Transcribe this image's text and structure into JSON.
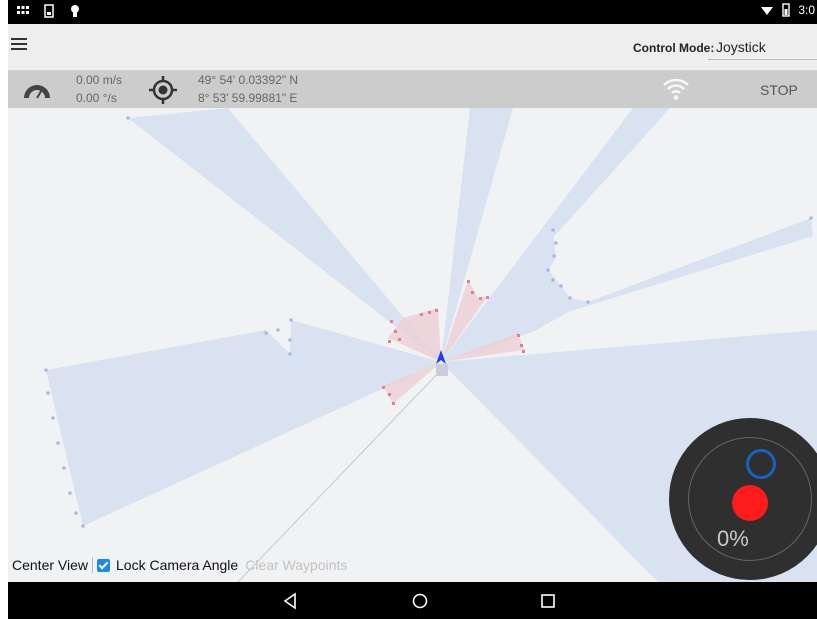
{
  "status_bar": {
    "time": "3:0",
    "icons": [
      "grid-icon",
      "sd-card-icon",
      "android-icon",
      "wifi-icon",
      "battery-icon"
    ]
  },
  "app_bar": {
    "control_mode_label": "Control Mode:",
    "control_mode_value": "Joystick"
  },
  "info_bar": {
    "speed_linear": "0.00 m/s",
    "speed_angular": "0.00 °/s",
    "latitude": "49° 54' 0.03392\" N",
    "longitude": "8° 53' 59.99881\" E",
    "stop_label": "STOP"
  },
  "controls": {
    "center_view": "Center View",
    "lock_camera_angle": "Lock Camera Angle",
    "lock_checked": true,
    "clear_waypoints": "Clear Waypoints"
  },
  "joystick": {
    "percent_text": "0%"
  },
  "colors": {
    "map_background": "#f1f2f4",
    "scan_fill": "#d9e2f0",
    "scan_point": "#a9b9e6",
    "obstacle_point": "#e08090",
    "robot_arrow": "#1e3ff0",
    "joystick_knob": "#ff1b1b",
    "joystick_target": "#1565c0",
    "checkbox": "#1e88e5"
  }
}
